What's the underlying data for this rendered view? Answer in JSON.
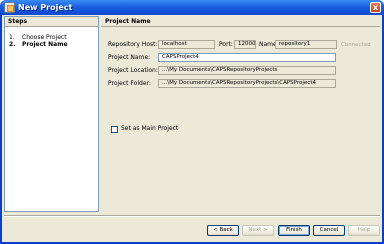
{
  "window": {
    "title": "New Project",
    "close_glyph": "x"
  },
  "steps": {
    "header": "Steps",
    "items": [
      {
        "num": "1.",
        "label": "Choose Project"
      },
      {
        "num": "2.",
        "label": "Project Name"
      }
    ]
  },
  "panel": {
    "header": "Project Name",
    "repository_host": {
      "label": "Repository Host:",
      "value": "localhost"
    },
    "port": {
      "label": "Port:",
      "value": "12000"
    },
    "name": {
      "label": "Name:",
      "value": "repository1"
    },
    "status": "Connected",
    "project_name": {
      "label": "Project Name:",
      "value": "CAPSProject4"
    },
    "project_location": {
      "label": "Project Location:",
      "value": "...\\My Documents\\CAPSRepositoryProjects"
    },
    "project_folder": {
      "label": "Project Folder:",
      "value": "...\\My Documents\\CAPSRepositoryProjects\\CAPSProject4"
    },
    "main_project": {
      "label": "Set as Main Project",
      "checked": false
    }
  },
  "buttons": {
    "back": "< Back",
    "next": "Next >",
    "finish": "Finish",
    "cancel": "Cancel",
    "help": "Help"
  }
}
